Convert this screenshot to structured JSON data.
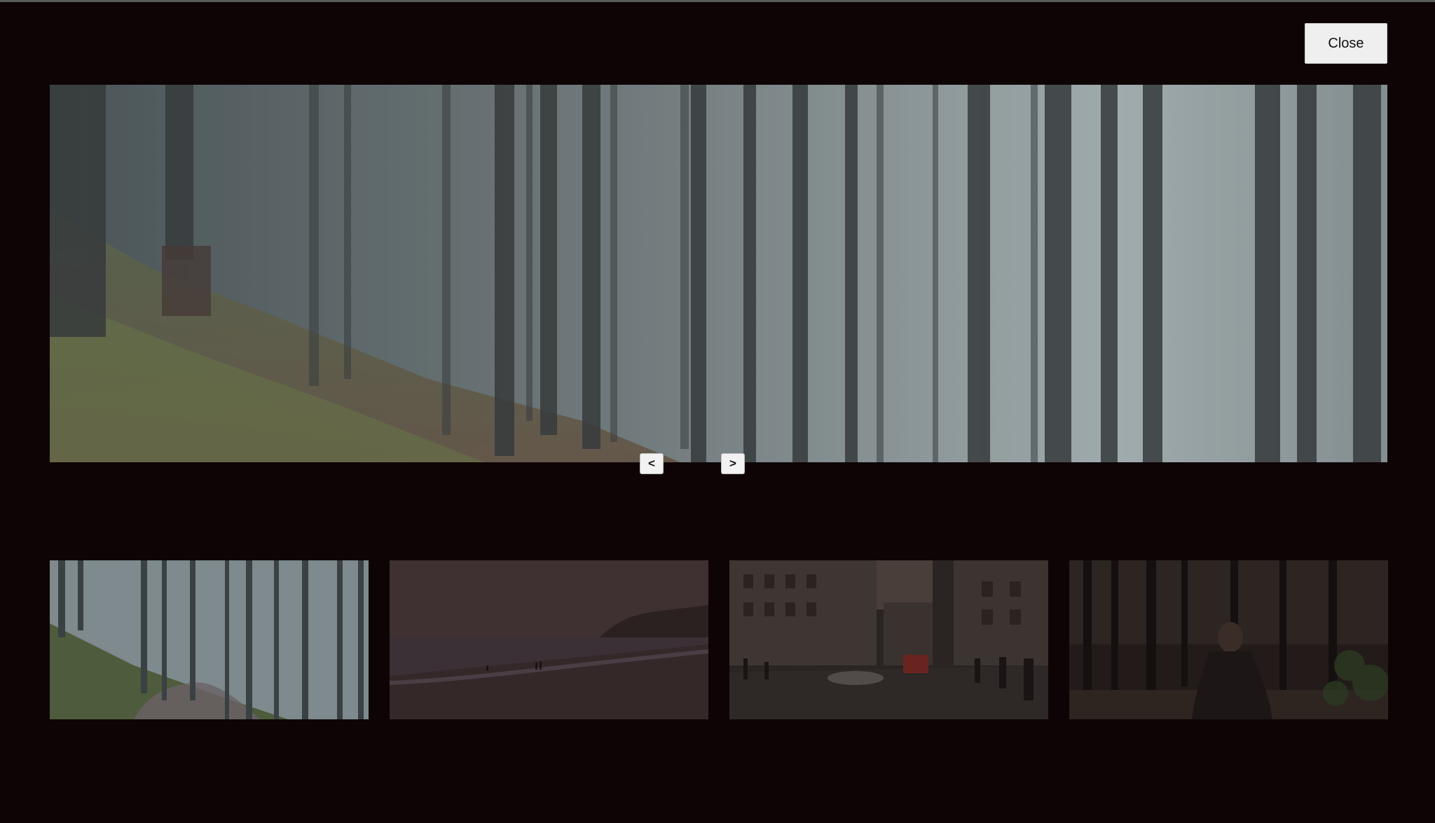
{
  "controls": {
    "close_label": "Close",
    "prev_label": "<",
    "next_label": ">"
  },
  "main_image": {
    "subject": "foggy-forest-hillside"
  },
  "thumbnails": [
    {
      "subject": "foggy-forest-path",
      "selected": true
    },
    {
      "subject": "misty-beach-shore",
      "selected": false
    },
    {
      "subject": "city-street-with-bus",
      "selected": false
    },
    {
      "subject": "woman-sitting-in-dark-forest",
      "selected": false
    }
  ],
  "colors": {
    "background": "#0e0405",
    "button_bg": "#efefef"
  }
}
